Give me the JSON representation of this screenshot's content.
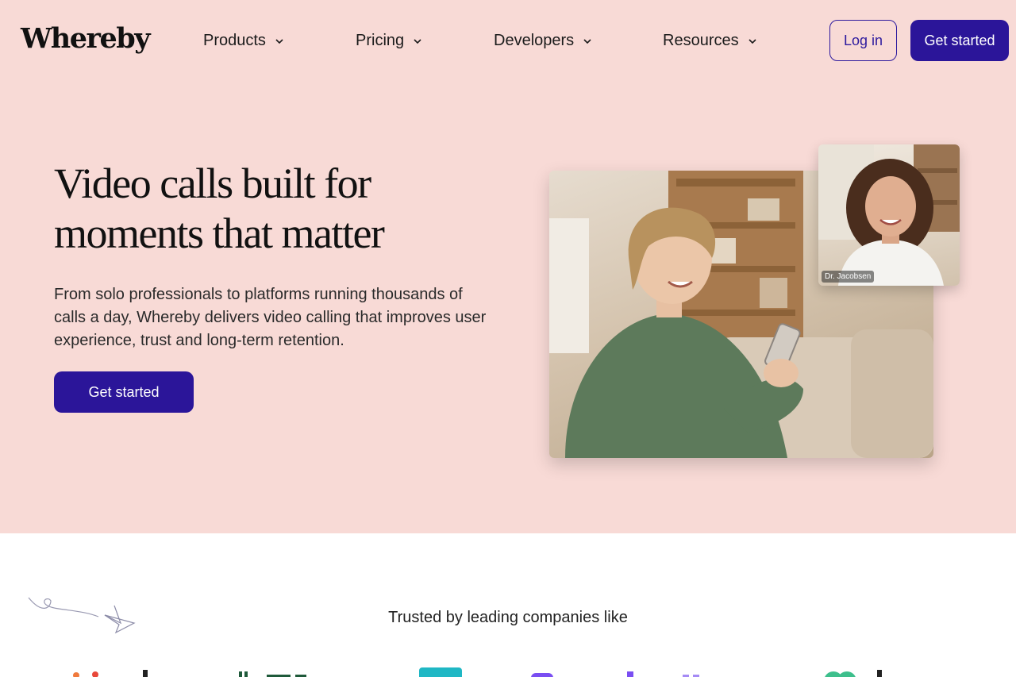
{
  "header": {
    "logo": "Whereby",
    "nav": [
      {
        "label": "Products"
      },
      {
        "label": "Pricing"
      },
      {
        "label": "Developers"
      },
      {
        "label": "Resources"
      }
    ],
    "login_label": "Log in",
    "get_started_label": "Get started"
  },
  "hero": {
    "title": "Video calls built for moments that matter",
    "subtitle": "From solo professionals to platforms running thousands of calls a day, Whereby delivers video calling that improves user experience, trust and long-term retention.",
    "cta_label": "Get started",
    "pip_name": "Dr. Jacobsen"
  },
  "trusted": {
    "heading": "Trusted by leading companies like"
  },
  "colors": {
    "hero_bg": "#f8dad6",
    "brand": "#2b1599"
  }
}
